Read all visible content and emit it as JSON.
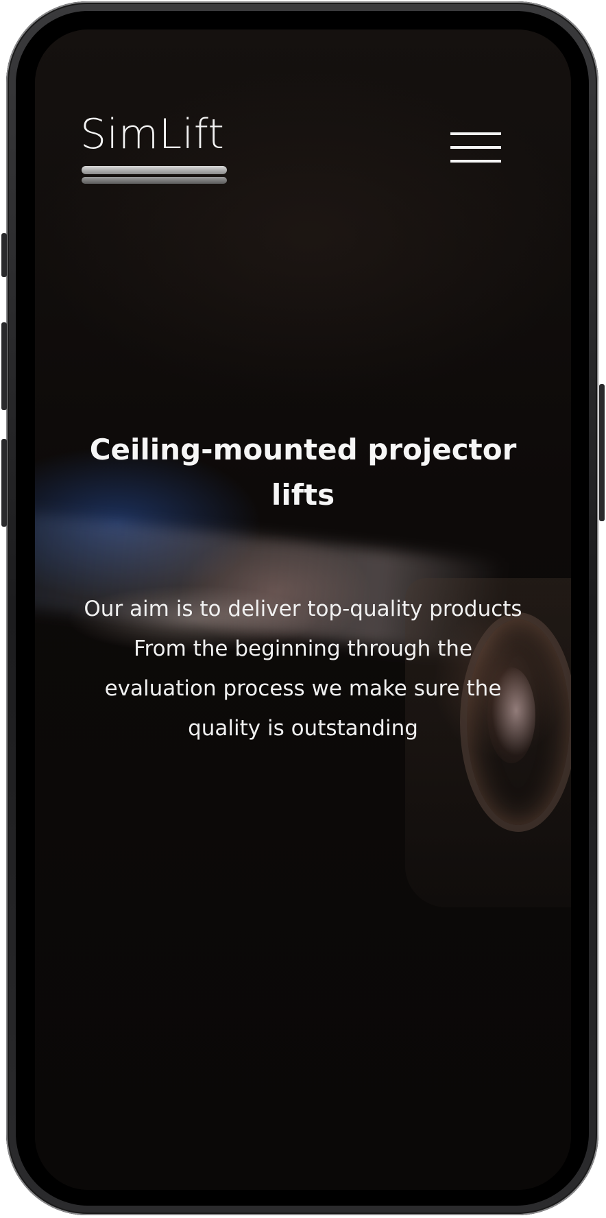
{
  "header": {
    "logo_text": "SimLift",
    "menu_icon": "hamburger-menu-icon"
  },
  "hero": {
    "title": "Ceiling-mounted projector lifts",
    "paragraphs": [
      "Our aim is to deliver top-quality products",
      "From the beginning through the evaluation process we make sure the quality is outstanding"
    ]
  },
  "colors": {
    "background": "#0c0908",
    "text": "#f6f6f6",
    "device_frame": "#1c1c1e"
  }
}
